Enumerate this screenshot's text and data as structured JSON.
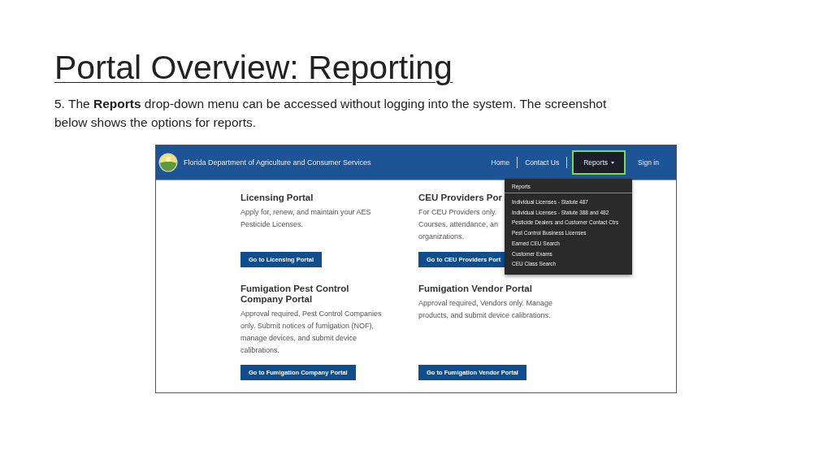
{
  "slide": {
    "title": "Portal Overview: Reporting",
    "text": "5. The **Reports** drop-down menu can be accessed without logging into the system. The screenshot below shows the options for reports."
  },
  "site": {
    "header": {
      "agency": "Florida Department of Agriculture and Consumer Services",
      "nav": [
        {
          "label": "Home",
          "selected": false,
          "dropdown": false
        },
        {
          "label": "Contact Us",
          "selected": false,
          "dropdown": false
        },
        {
          "label": "Reports",
          "selected": true,
          "dropdown": true
        },
        {
          "label": "Sign in",
          "selected": false,
          "dropdown": false
        }
      ]
    },
    "dropdown": {
      "heading": "Reports",
      "items": [
        "Individual Licenses - Statute 487",
        "Individual Licenses - Statute 388 and 482",
        "Pesticide Dealers and Customer Contact Ctrs",
        "Pest Control Business Licenses",
        "Earned CEU Search",
        "Customer Exams",
        "CEU Class Search"
      ]
    },
    "cards": [
      {
        "title": "Licensing Portal",
        "description": [
          "Apply for, renew, and maintain your AES",
          "Pesticide Licenses."
        ],
        "button": "Go to Licensing Portal"
      },
      {
        "title": "CEU Providers Por",
        "description": [
          "For CEU Providers only.",
          "Courses, attendance, an",
          "organizations."
        ],
        "button": "Go to CEU Providers Port"
      },
      {
        "title": "Fumigation Pest Control Company Portal",
        "description": [
          "Approval required, Pest Control Companies",
          "only. Submit notices of fumigation (NOF),",
          "manage devices, and submit device",
          "calibrations."
        ],
        "button": "Go to Fumigation Company Portal"
      },
      {
        "title": "Fumigation Vendor Portal",
        "description": [
          "Approval required, Vendors only. Manage",
          "products, and submit device calibrations."
        ],
        "button": "Go to Fumigation Vendor Portal"
      }
    ]
  }
}
